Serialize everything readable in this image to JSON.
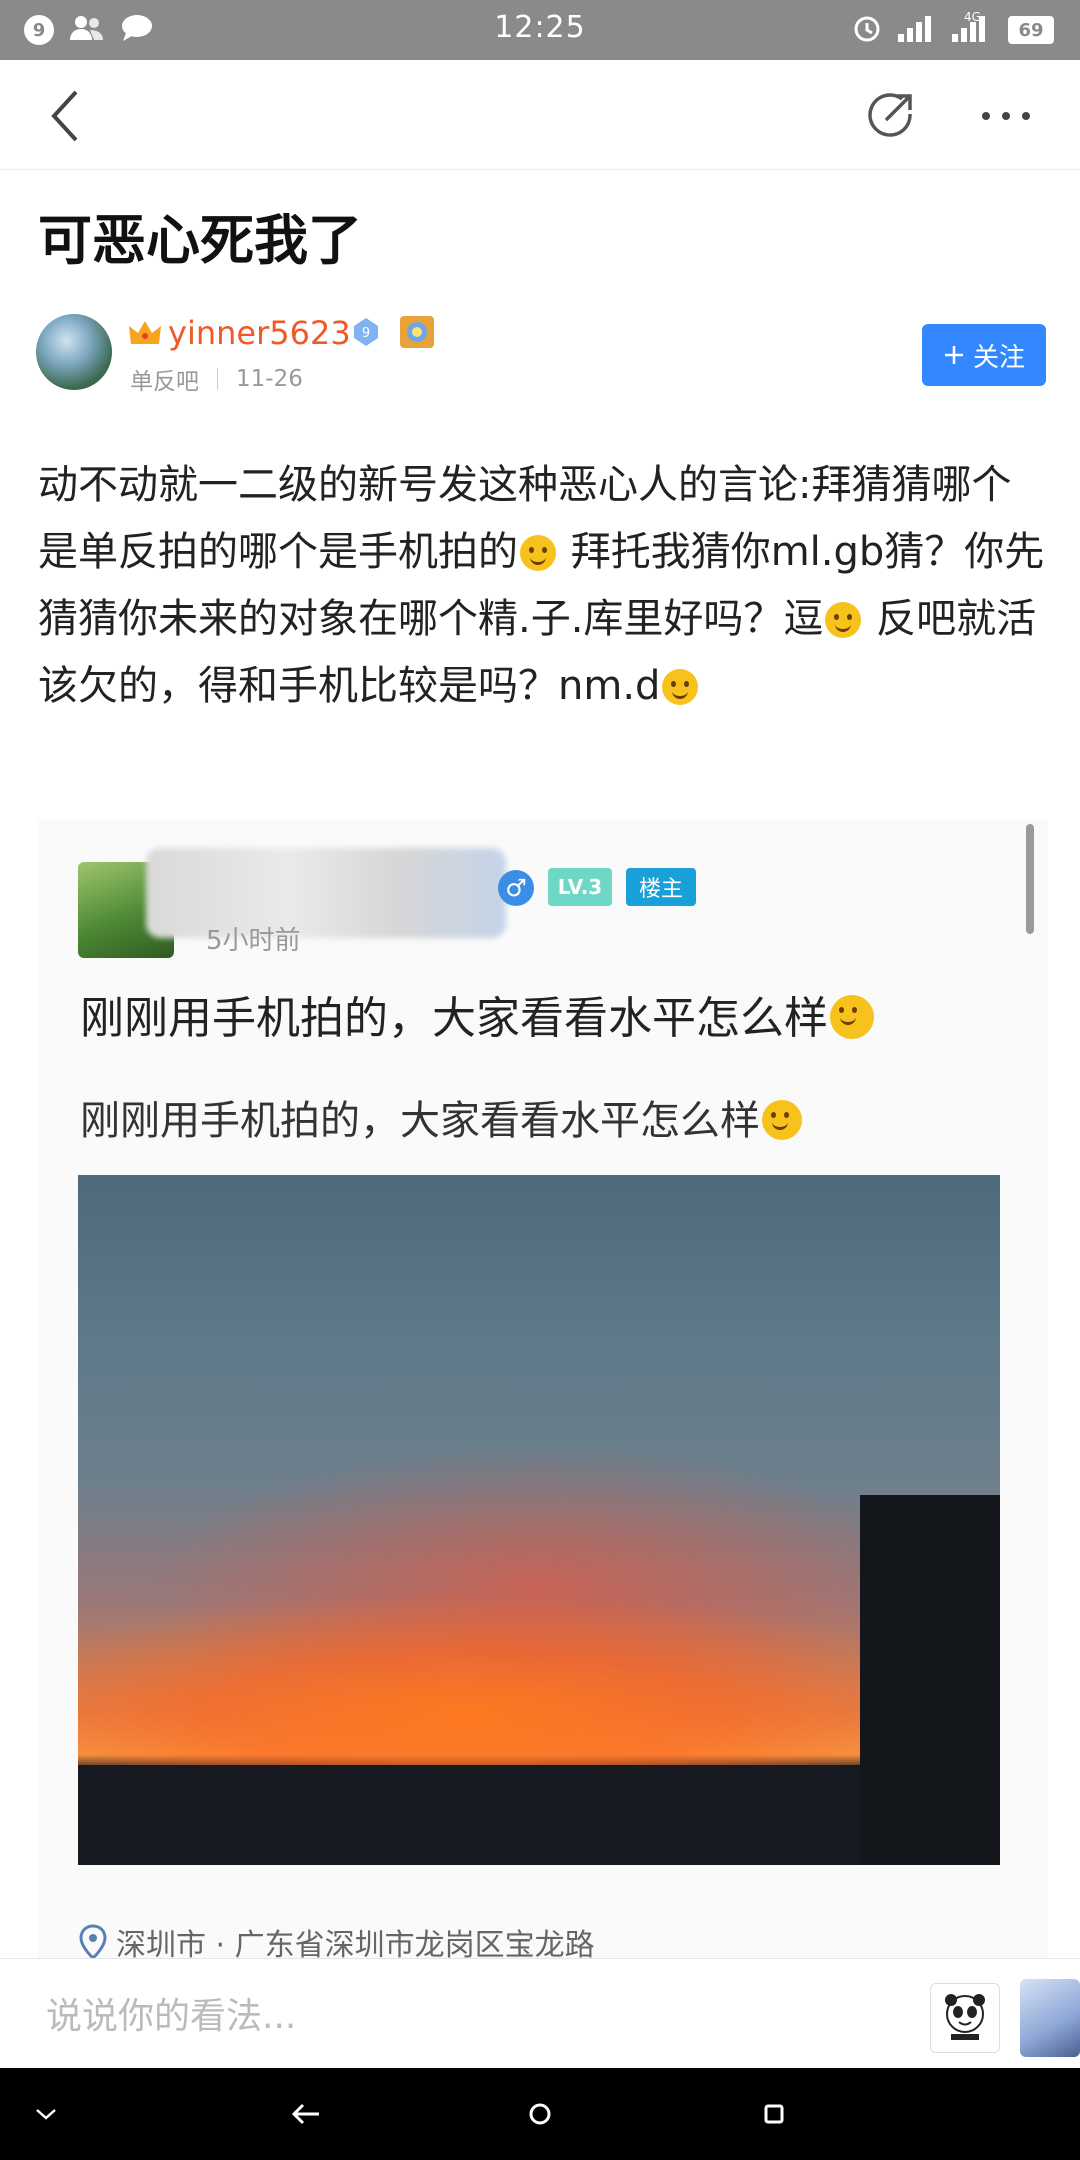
{
  "status_bar": {
    "notification_count": "9",
    "time": "12:25",
    "network_label": "4G",
    "battery": "69"
  },
  "nav": {
    "back_icon": "chevron-left-icon",
    "share_icon": "share-icon",
    "more_icon": "more-icon"
  },
  "post": {
    "title": "可恶心死我了",
    "author": {
      "name": "yinner5623",
      "level": "9",
      "forum": "单反吧",
      "date": "11-26"
    },
    "follow_label": "关注",
    "body": {
      "p1": "动不动就一二级的新号发这种恶心人的言论:拜猜猜哪个是单反拍的哪个是手机拍的",
      "p2": " 拜托我猜你ml.gb猜？你先猜猜你未来的对象在哪个精.子.库里好吗？逗",
      "p3": " 反吧就活该欠的，得和手机比较是吗？nm.d"
    }
  },
  "screenshot": {
    "level_badge": "LV.3",
    "owner_badge": "楼主",
    "time": "5小时前",
    "line1": "刚刚用手机拍的，大家看看水平怎么样",
    "line2": "刚刚用手机拍的，大家看看水平怎么样",
    "location": "深圳市 · 广东省深圳市龙岗区宝龙路"
  },
  "comment_bar": {
    "placeholder": "说说你的看法..."
  },
  "colors": {
    "accent": "#3388ff",
    "author_name": "#f05a28"
  }
}
